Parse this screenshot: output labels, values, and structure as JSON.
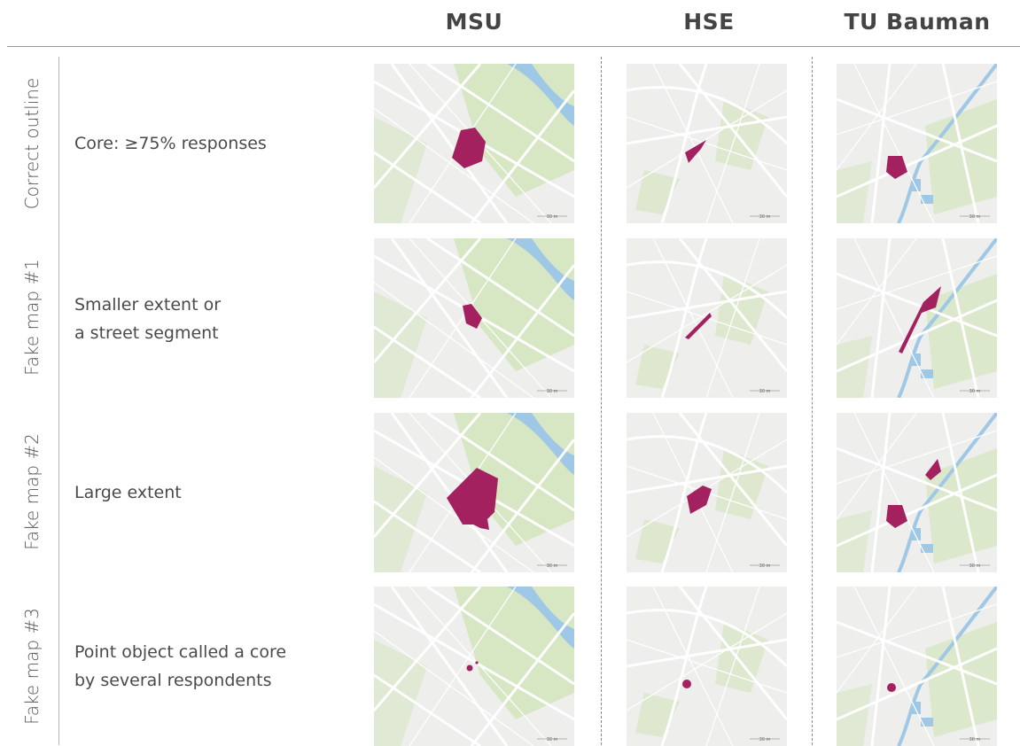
{
  "columns": [
    "MSU",
    "HSE",
    "TU Bauman"
  ],
  "rows": [
    {
      "label": "Correct outline",
      "description": "Core: ≥75% responses"
    },
    {
      "label": "Fake map #1",
      "description": "Smaller extent or\na street segment"
    },
    {
      "label": "Fake map #2",
      "description": "Large extent"
    },
    {
      "label": "Fake map #3",
      "description": "Point object called a core\nby several respondents"
    }
  ],
  "scale_label": "30 m",
  "colors": {
    "core": "#a3215f",
    "water": "#9fc8e6",
    "park": "#d7e6c3",
    "land": "#eeeeec",
    "road": "#ffffff"
  }
}
